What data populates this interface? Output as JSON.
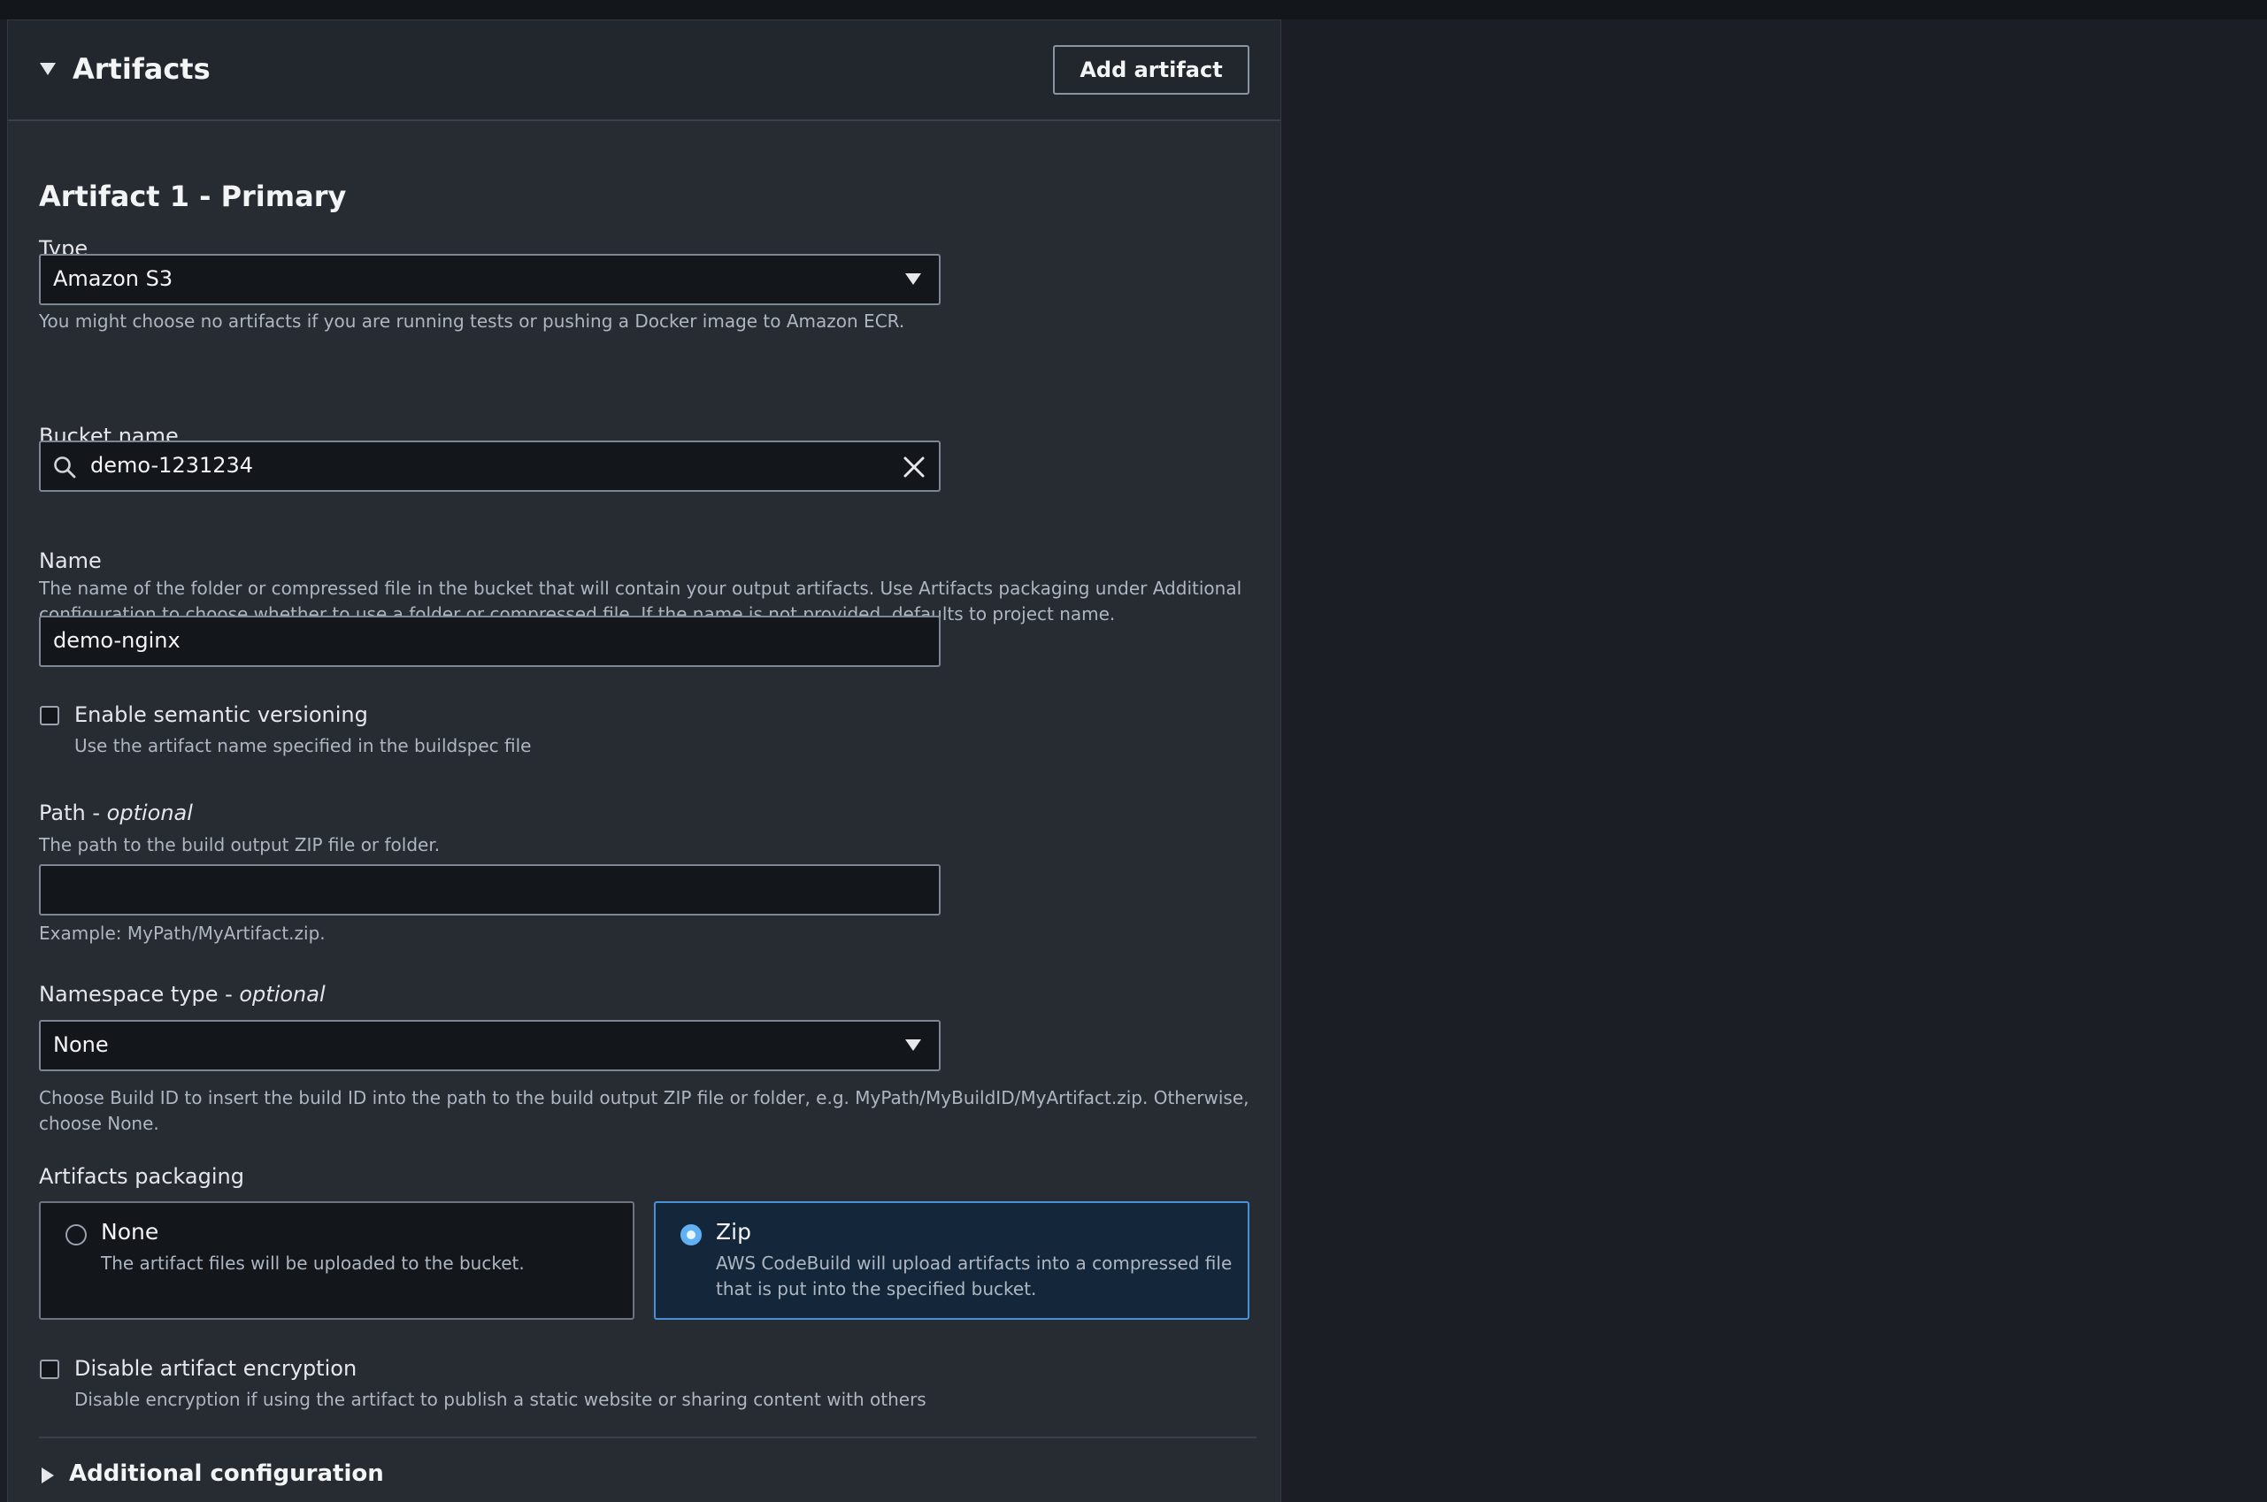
{
  "panel": {
    "title": "Artifacts",
    "add_button_label": "Add artifact"
  },
  "artifact": {
    "heading": "Artifact 1 - Primary",
    "type": {
      "label": "Type",
      "value": "Amazon S3",
      "hint": "You might choose no artifacts if you are running tests or pushing a Docker image to Amazon ECR."
    },
    "bucket": {
      "label": "Bucket name",
      "value": "demo-1231234"
    },
    "name": {
      "label": "Name",
      "hint": "The name of the folder or compressed file in the bucket that will contain your output artifacts. Use Artifacts packaging under Additional configuration to choose whether to use a folder or compressed file. If the name is not provided, defaults to project name.",
      "value": "demo-nginx"
    },
    "semantic_versioning": {
      "label": "Enable semantic versioning",
      "hint": "Use the artifact name specified in the buildspec file",
      "checked": false
    },
    "path": {
      "label": "Path",
      "optional": "optional",
      "hint": "The path to the build output ZIP file or folder.",
      "value": "",
      "example": "Example: MyPath/MyArtifact.zip."
    },
    "namespace": {
      "label": "Namespace type",
      "optional": "optional",
      "value": "None",
      "hint": "Choose Build ID to insert the build ID into the path to the build output ZIP file or folder, e.g. MyPath/MyBuildID/MyArtifact.zip. Otherwise, choose None."
    },
    "packaging": {
      "label": "Artifacts packaging",
      "options": [
        {
          "label": "None",
          "desc": "The artifact files will be uploaded to the bucket.",
          "selected": false
        },
        {
          "label": "Zip",
          "desc": "AWS CodeBuild will upload artifacts into a compressed file that is put into the specified bucket.",
          "selected": true
        }
      ]
    },
    "encryption": {
      "label": "Disable artifact encryption",
      "hint": "Disable encryption if using the artifact to publish a static website or sharing content with others",
      "checked": false
    },
    "additional_config": {
      "label": "Additional configuration"
    }
  },
  "colors": {
    "accent": "#5fb0f5",
    "panel_bg": "#272b32",
    "page_bg": "#1b1e24"
  }
}
